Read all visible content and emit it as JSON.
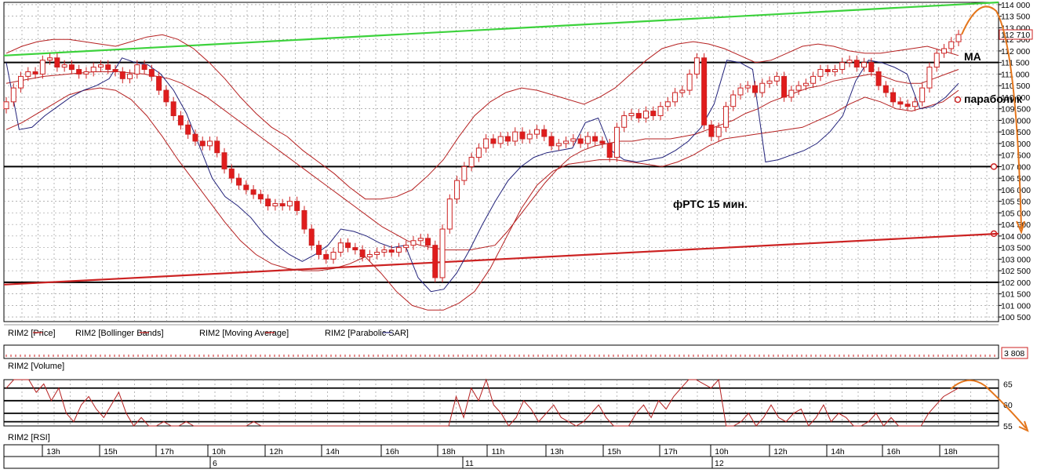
{
  "chart_data": [
    {
      "type": "candlestick",
      "panel": "price",
      "title": "",
      "ylim": [
        100.3,
        114.1
      ],
      "y_ticks": [
        "114 000",
        "113 500",
        "113 000",
        "112 500",
        "112 000",
        "111 500",
        "111 000",
        "110 500",
        "110 000",
        "109 500",
        "109 000",
        "108 500",
        "108 000",
        "107 500",
        "107 000",
        "106 500",
        "106 000",
        "105 500",
        "105 000",
        "104 500",
        "104 000",
        "103 500",
        "103 000",
        "102 500",
        "102 000",
        "101 500",
        "101 000",
        "100 500"
      ],
      "y_tick_values": [
        114,
        113.5,
        113,
        112.5,
        112,
        111.5,
        111,
        110.5,
        110,
        109.5,
        109,
        108.5,
        108,
        107.5,
        107,
        106.5,
        106,
        105.5,
        105,
        104.5,
        104,
        103.5,
        103,
        102.5,
        102,
        101.5,
        101,
        100.5
      ],
      "last_price_label": "112 710",
      "x_time_labels": [
        "13h",
        "15h",
        "17h",
        "10h",
        "12h",
        "14h",
        "16h",
        "18h",
        "11h",
        "13h",
        "15h",
        "17h",
        "10h",
        "12h",
        "14h",
        "16h",
        "18h"
      ],
      "x_date_labels": [
        "6",
        "11",
        "12"
      ],
      "grid": true,
      "closes": [
        109.8,
        110.4,
        110.9,
        111.1,
        111.0,
        111.6,
        111.7,
        111.3,
        111.4,
        111.2,
        111.0,
        111.1,
        111.3,
        111.4,
        111.2,
        111.1,
        110.8,
        111.0,
        111.4,
        111.2,
        110.9,
        110.3,
        109.8,
        109.2,
        108.8,
        108.4,
        108.1,
        107.9,
        108.1,
        107.6,
        106.9,
        106.5,
        106.2,
        106.0,
        105.8,
        105.6,
        105.3,
        105.4,
        105.3,
        105.5,
        105.1,
        104.3,
        103.6,
        103.2,
        103.0,
        103.3,
        103.7,
        103.5,
        103.4,
        103.1,
        103.2,
        103.3,
        103.4,
        103.3,
        103.5,
        103.6,
        103.8,
        103.9,
        103.6,
        102.2,
        104.3,
        105.6,
        106.4,
        107.0,
        107.4,
        107.8,
        108.2,
        108.0,
        108.3,
        108.1,
        108.5,
        108.2,
        108.4,
        108.6,
        108.3,
        107.9,
        108.0,
        108.1,
        108.2,
        108.0,
        108.3,
        108.1,
        108.0,
        107.4,
        108.7,
        109.2,
        109.3,
        109.1,
        109.4,
        109.2,
        109.6,
        109.8,
        110.2,
        110.3,
        111.0,
        111.7,
        108.8,
        108.3,
        108.7,
        109.6,
        110.1,
        110.4,
        110.5,
        110.2,
        110.6,
        110.7,
        110.9,
        110.0,
        110.3,
        110.5,
        110.6,
        110.9,
        111.2,
        111.1,
        111.2,
        111.5,
        111.6,
        111.3,
        111.5,
        111.1,
        110.5,
        110.2,
        109.8,
        109.7,
        109.6,
        109.8,
        110.4,
        111.3,
        111.9,
        112.1,
        112.4,
        112.71
      ],
      "moving_average": [
        110.6,
        110.7,
        110.8,
        110.9,
        110.95,
        111.0,
        111.05,
        111.1,
        111.1,
        111.1,
        111.05,
        111.0,
        110.9,
        110.8,
        110.6,
        110.3,
        110.0,
        109.6,
        109.2,
        108.8,
        108.4,
        108.0,
        107.6,
        107.2,
        106.8,
        106.4,
        106.0,
        105.6,
        105.2,
        104.8,
        104.4,
        104.1,
        103.8,
        103.6,
        103.5,
        103.4,
        103.4,
        103.4,
        103.5,
        103.6,
        104.2,
        104.9,
        105.6,
        106.3,
        106.9,
        107.4,
        107.7,
        107.9,
        108.0,
        108.1,
        108.1,
        108.2,
        108.2,
        108.2,
        108.3,
        108.4,
        108.6,
        108.8,
        109.0,
        109.3,
        109.5,
        109.8,
        110.0,
        110.2,
        110.4,
        110.5,
        110.7,
        110.8,
        110.9,
        111.0,
        110.9,
        110.7,
        110.6,
        110.6,
        110.8,
        111.0,
        111.2
      ],
      "bollinger_upper": [
        111.9,
        112.2,
        112.4,
        112.5,
        112.5,
        112.4,
        112.3,
        112.2,
        112.4,
        112.6,
        112.7,
        112.5,
        112.1,
        111.5,
        110.8,
        110.0,
        109.3,
        108.7,
        108.3,
        107.7,
        107.2,
        106.7,
        106.1,
        105.6,
        105.6,
        105.7,
        106.0,
        106.6,
        107.3,
        108.3,
        109.2,
        109.8,
        110.2,
        110.4,
        110.3,
        110.1,
        109.9,
        109.7,
        110.0,
        110.4,
        111.0,
        111.6,
        112.1,
        112.3,
        112.4,
        112.3,
        112.1,
        111.8,
        111.5,
        111.6,
        111.9,
        112.2,
        112.3,
        112.2,
        112.0,
        111.9,
        111.9,
        112.0,
        112.1,
        112.2,
        112.0,
        111.8
      ],
      "bollinger_lower": [
        108.6,
        108.9,
        109.3,
        109.7,
        110.1,
        110.3,
        110.4,
        110.3,
        109.9,
        109.2,
        108.3,
        107.3,
        106.4,
        105.5,
        104.6,
        103.8,
        103.2,
        102.8,
        102.6,
        102.5,
        102.5,
        102.6,
        102.8,
        103.1,
        102.4,
        101.6,
        101.0,
        100.8,
        100.8,
        101.1,
        101.6,
        102.6,
        103.9,
        105.2,
        106.2,
        106.8,
        107.1,
        107.2,
        107.3,
        107.3,
        107.2,
        107.1,
        107.0,
        107.2,
        107.5,
        107.9,
        108.2,
        108.3,
        108.4,
        108.5,
        108.6,
        108.7,
        109.0,
        109.3,
        109.7,
        110.0,
        109.8,
        109.5,
        109.4,
        109.6,
        109.8,
        110.3
      ],
      "parabolic_sar": [
        111.5,
        108.6,
        108.7,
        109.2,
        109.6,
        110.0,
        110.3,
        110.5,
        110.8,
        111.7,
        111.5,
        111.4,
        111.0,
        110.3,
        109.3,
        107.9,
        106.5,
        105.7,
        105.3,
        104.8,
        104.1,
        103.6,
        103.2,
        102.9,
        103.2,
        103.6,
        104.3,
        104.2,
        104.0,
        103.7,
        103.5,
        103.6,
        102.2,
        101.6,
        101.7,
        102.4,
        103.4,
        104.5,
        105.5,
        106.4,
        107.0,
        107.4,
        107.6,
        107.7,
        107.8,
        108.9,
        109.1,
        107.7,
        107.3,
        107.2,
        107.3,
        107.4,
        107.7,
        108.1,
        108.7,
        109.7,
        111.6,
        111.5,
        111.2,
        107.2,
        107.3,
        107.5,
        107.7,
        108.0,
        108.5,
        109.2,
        110.7,
        111.6,
        111.5,
        111.3,
        111.0,
        109.5,
        109.6,
        110.0,
        110.6
      ],
      "trendlines": [
        {
          "name": "upper",
          "color": "#3cd23c",
          "from": 111.8,
          "to": 114.1
        },
        {
          "name": "lower",
          "color": "#cc2222",
          "from": 101.9,
          "to": 104.1
        }
      ],
      "horizontal_levels": [
        111.5,
        107.0,
        102.0
      ],
      "annotations": {
        "ma_label": "MA",
        "parabolic_label": "параболик",
        "instrument_label": "фРТС   15 мин."
      },
      "legend": [
        {
          "label": "RIM2 [Price]",
          "color": "#cc2222"
        },
        {
          "label": "RIM2 [Bollinger Bands]",
          "color": "#cc2222"
        },
        {
          "label": "RIM2 [Moving Average]",
          "color": "#cc2222"
        },
        {
          "label": "RIM2 [Parabolic SAR]",
          "color": "#22227a"
        }
      ]
    },
    {
      "type": "bar",
      "panel": "volume",
      "title": "RIM2 [Volume]",
      "last_value_label": "3 808"
    },
    {
      "type": "line",
      "panel": "rsi",
      "title": "RIM2 [RSI]",
      "ylim": [
        55,
        66
      ],
      "y_ticks": [
        "65",
        "60",
        "55"
      ],
      "y_tick_values": [
        65,
        60,
        55
      ],
      "horizontal_levels": [
        64,
        61,
        58,
        56
      ],
      "values": [
        64,
        68,
        72,
        66,
        63,
        65,
        61,
        64,
        58,
        56,
        60,
        62,
        59,
        57,
        60,
        63,
        58,
        55,
        57,
        53,
        54,
        56,
        55,
        52,
        56,
        53,
        52,
        54,
        55,
        53,
        51,
        54,
        55,
        56,
        53,
        52,
        54,
        51,
        49,
        48,
        47,
        46,
        48,
        47,
        45,
        47,
        46,
        44,
        45,
        47,
        46,
        45,
        44,
        43,
        45,
        47,
        46,
        48,
        47,
        45,
        62,
        57,
        64,
        61,
        66,
        60,
        58,
        55,
        57,
        61,
        59,
        56,
        58,
        60,
        57,
        56,
        53,
        56,
        58,
        60,
        57,
        55,
        54,
        49,
        58,
        60,
        57,
        61,
        59,
        62,
        64,
        66,
        67,
        65,
        64,
        68,
        55,
        53,
        56,
        58,
        55,
        57,
        60,
        57,
        56,
        58,
        59,
        55,
        57,
        60,
        56,
        58,
        57,
        55,
        54,
        56,
        58,
        55,
        57,
        54,
        53,
        52,
        55,
        58,
        60,
        62,
        63,
        64
      ]
    }
  ]
}
